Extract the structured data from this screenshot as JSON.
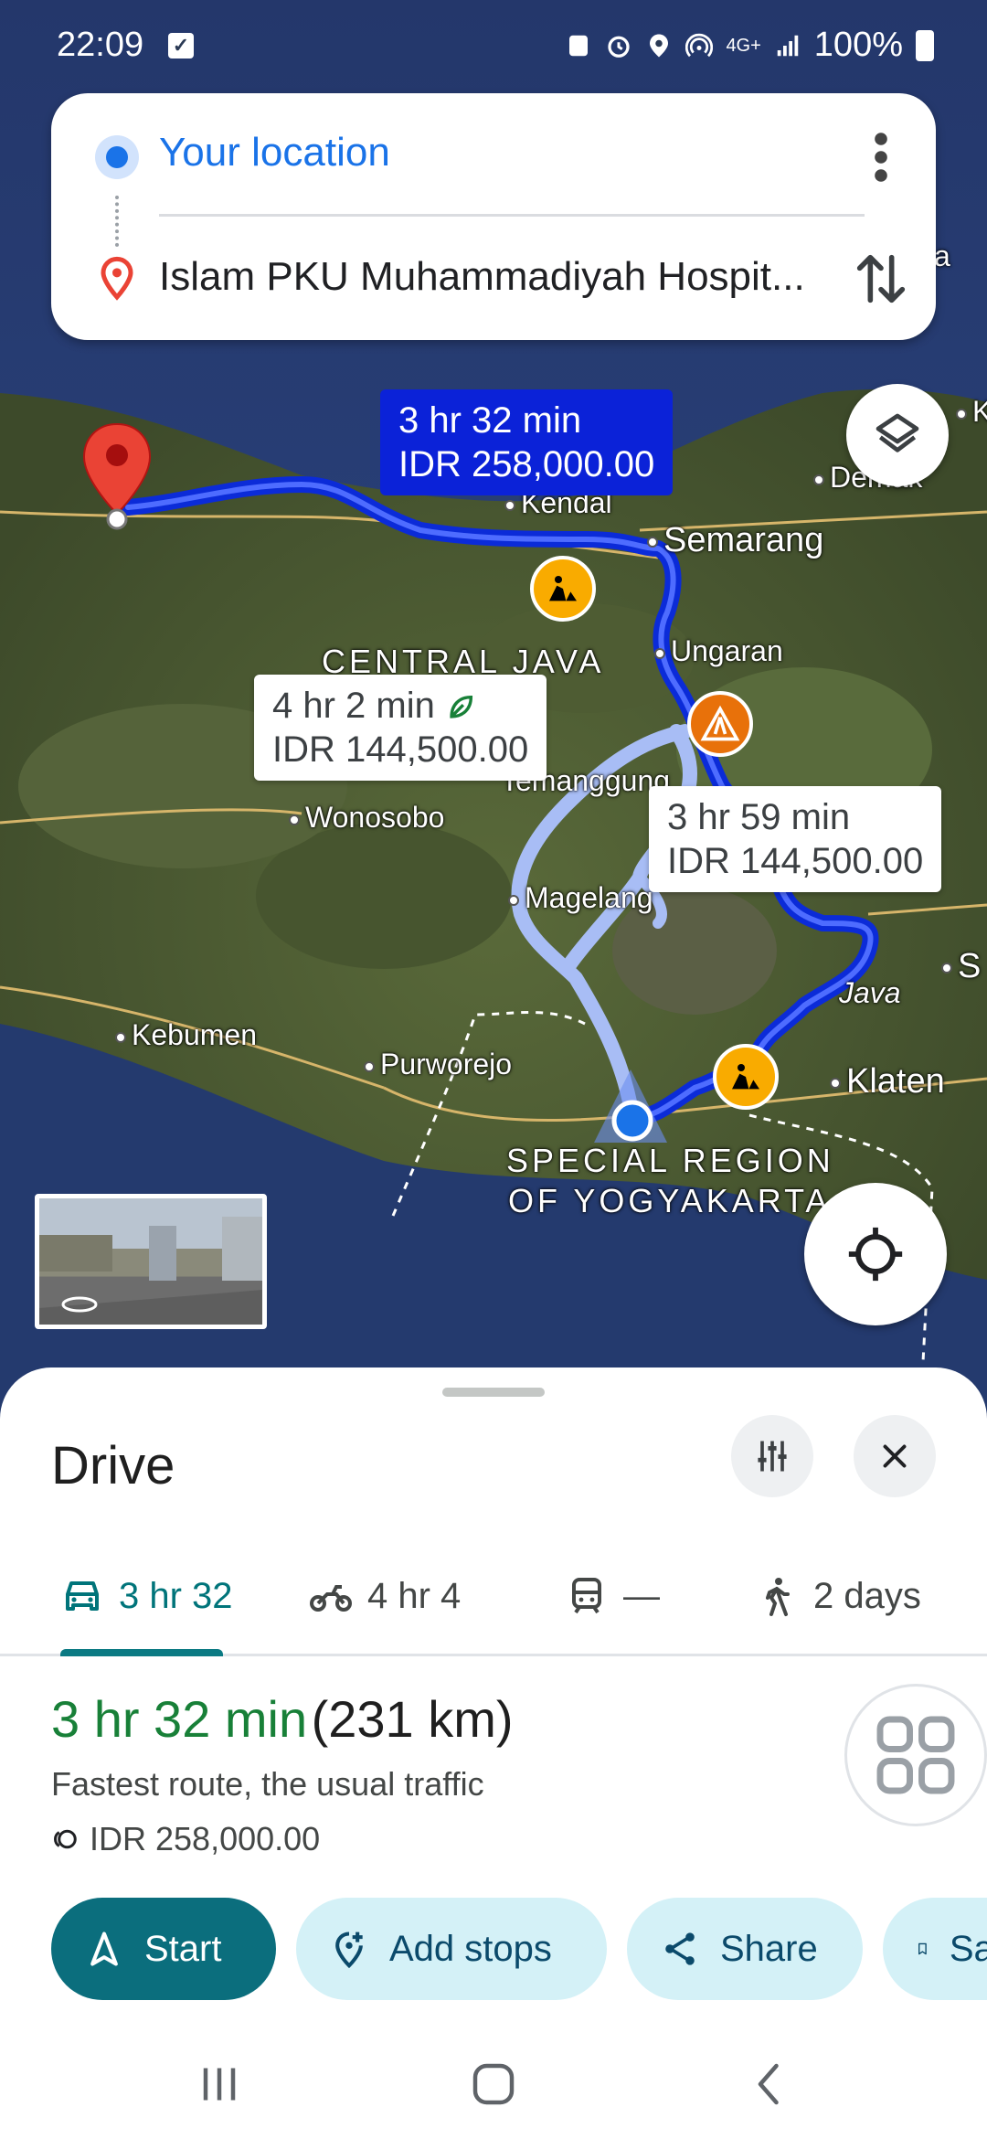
{
  "status_bar": {
    "time": "22:09",
    "battery": "100%",
    "network": "4G+"
  },
  "directions": {
    "origin": "Your location",
    "destination": "Islam PKU Muhammadiyah Hospit..."
  },
  "map": {
    "places": [
      "Kendal",
      "Semarang",
      "Demak",
      "Ungaran",
      "Temanggung",
      "Wonosobo",
      "Magelang",
      "Kebumen",
      "Purworejo",
      "Klaten",
      "Java",
      "S",
      "K",
      "a"
    ],
    "regions": [
      "CENTRAL JAVA",
      "SPECIAL REGION",
      "OF YOGYAKARTA"
    ],
    "route_callouts": [
      {
        "duration": "3 hr 32 min",
        "cost": "IDR 258,000.00",
        "selected": true
      },
      {
        "duration": "4 hr 2 min",
        "cost": "IDR 144,500.00",
        "eco": true
      },
      {
        "duration": "3 hr 59 min",
        "cost": "IDR 144,500.00"
      }
    ]
  },
  "sheet": {
    "title": "Drive",
    "modes": [
      {
        "icon": "car-icon",
        "label": "3 hr 32",
        "active": true
      },
      {
        "icon": "motorcycle-icon",
        "label": "4 hr 4"
      },
      {
        "icon": "transit-icon",
        "label": "—"
      },
      {
        "icon": "walk-icon",
        "label": "2 days"
      }
    ],
    "summary": {
      "duration": "3 hr 32 min",
      "distance": "(231 km)",
      "description": "Fastest route, the usual traffic",
      "toll": "IDR 258,000.00"
    },
    "actions": {
      "start": "Start",
      "add_stops": "Add stops",
      "share": "Share",
      "save": "Save"
    }
  },
  "colors": {
    "route_primary": "#0b2bd8",
    "route_alt": "#a8bdf5",
    "accent_teal": "#0b6e7d",
    "duration_green": "#188038"
  }
}
